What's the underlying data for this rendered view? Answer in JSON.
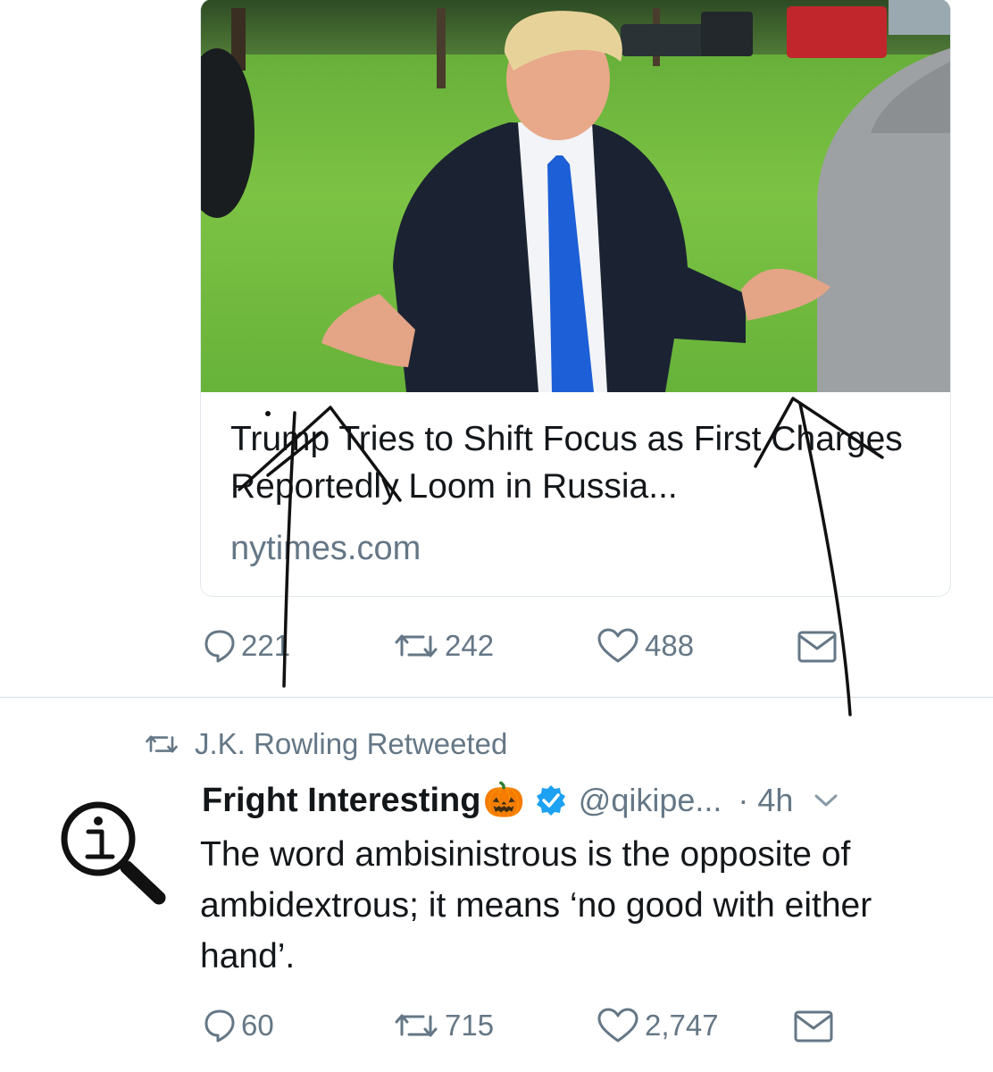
{
  "tweet1": {
    "card": {
      "title": "Trump Tries to Shift Focus as First Charges Reportedly Loom in Russia...",
      "domain": "nytimes.com"
    },
    "actions": {
      "reply_count": "221",
      "retweet_count": "242",
      "like_count": "488"
    }
  },
  "retweet_header": {
    "label": "J.K. Rowling Retweeted"
  },
  "tweet2": {
    "author_name": "Fright Interesting",
    "author_emoji": "🎃",
    "verified_icon": "verified-badge-icon",
    "handle": "@qikipe...",
    "time": "· 4h",
    "text": "The word ambisinistrous is the opposite of ambidextrous; it means ‘no good with either hand’.",
    "actions": {
      "reply_count": "60",
      "retweet_count": "715",
      "like_count": "2,747"
    }
  },
  "colors": {
    "text": "#14171a",
    "secondary": "#657786",
    "verified": "#1da1f2",
    "border": "#e1e8ed",
    "lawn": "#6eb83c",
    "suit": "#1b2333",
    "tie": "#1c5fd6"
  }
}
